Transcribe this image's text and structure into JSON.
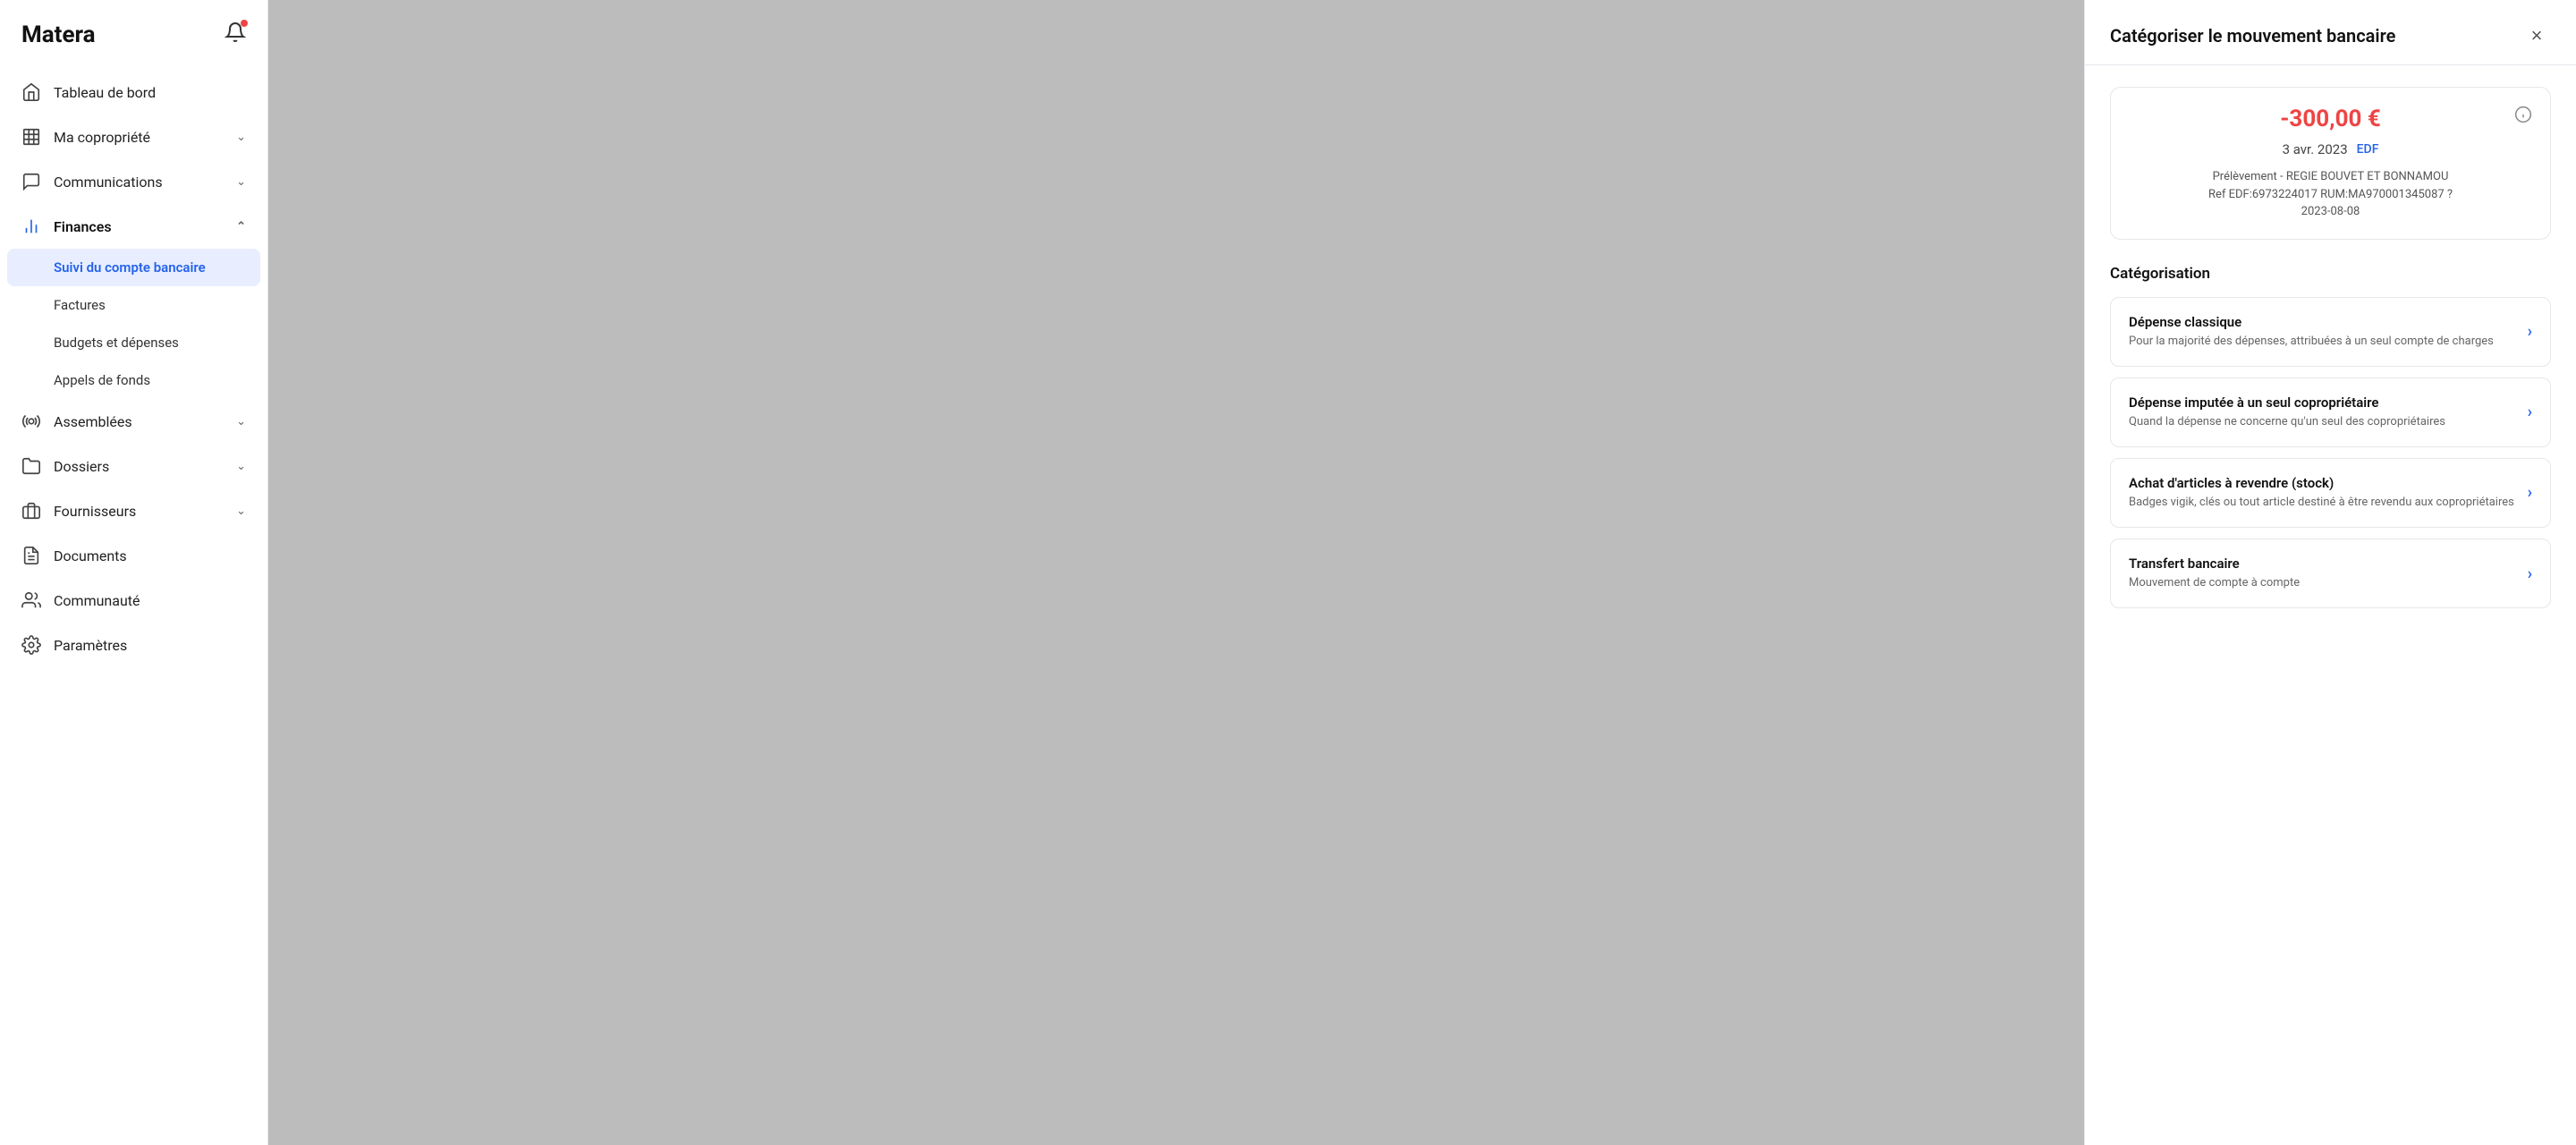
{
  "app": {
    "logo": "Matera"
  },
  "sidebar": {
    "items": [
      {
        "id": "tableau-de-bord",
        "label": "Tableau de bord",
        "icon": "home-icon",
        "expandable": false
      },
      {
        "id": "ma-copropriete",
        "label": "Ma copropriété",
        "icon": "building-icon",
        "expandable": true
      },
      {
        "id": "communications",
        "label": "Communications",
        "icon": "chat-icon",
        "expandable": true
      },
      {
        "id": "finances",
        "label": "Finances",
        "icon": "chart-icon",
        "expandable": true,
        "active": true
      }
    ],
    "sub_items": [
      {
        "id": "suivi-du-compte-bancaire",
        "label": "Suivi du compte bancaire",
        "active": true
      },
      {
        "id": "factures",
        "label": "Factures",
        "active": false
      },
      {
        "id": "budgets-et-depenses",
        "label": "Budgets et dépenses",
        "active": false
      },
      {
        "id": "appels-de-fonds",
        "label": "Appels de fonds",
        "active": false
      }
    ],
    "other_items": [
      {
        "id": "assemblees",
        "label": "Assemblées",
        "icon": "assemblees-icon",
        "expandable": true
      },
      {
        "id": "dossiers",
        "label": "Dossiers",
        "icon": "dossiers-icon",
        "expandable": true
      },
      {
        "id": "fournisseurs",
        "label": "Fournisseurs",
        "icon": "fournisseurs-icon",
        "expandable": true
      },
      {
        "id": "documents",
        "label": "Documents",
        "icon": "documents-icon",
        "expandable": false
      },
      {
        "id": "communaute",
        "label": "Communauté",
        "icon": "communaute-icon",
        "expandable": false
      },
      {
        "id": "parametres",
        "label": "Paramètres",
        "icon": "parametres-icon",
        "expandable": false
      }
    ]
  },
  "panel": {
    "title": "Catégoriser le mouvement bancaire",
    "close_label": "×",
    "transaction": {
      "amount": "-300,00 €",
      "date": "3 avr. 2023",
      "vendor": "EDF",
      "description": "Prélèvement - REGIE BOUVET ET BONNAMOU\nRef EDF:6973224017 RUM:MA970001345087 ?\n2023-08-08"
    },
    "categorisation": {
      "title": "Catégorisation",
      "items": [
        {
          "id": "depense-classique",
          "title": "Dépense classique",
          "description": "Pour la majorité des dépenses, attribuées à un seul compte de charges"
        },
        {
          "id": "depense-imputee",
          "title": "Dépense imputée à un seul copropriétaire",
          "description": "Quand la dépense ne concerne qu'un seul des copropriétaires"
        },
        {
          "id": "achat-articles",
          "title": "Achat d'articles à revendre (stock)",
          "description": "Badges vigik, clés ou tout article destiné à être revendu aux copropriétaires"
        },
        {
          "id": "transfert-bancaire",
          "title": "Transfert bancaire",
          "description": "Mouvement de compte à compte"
        }
      ]
    }
  }
}
